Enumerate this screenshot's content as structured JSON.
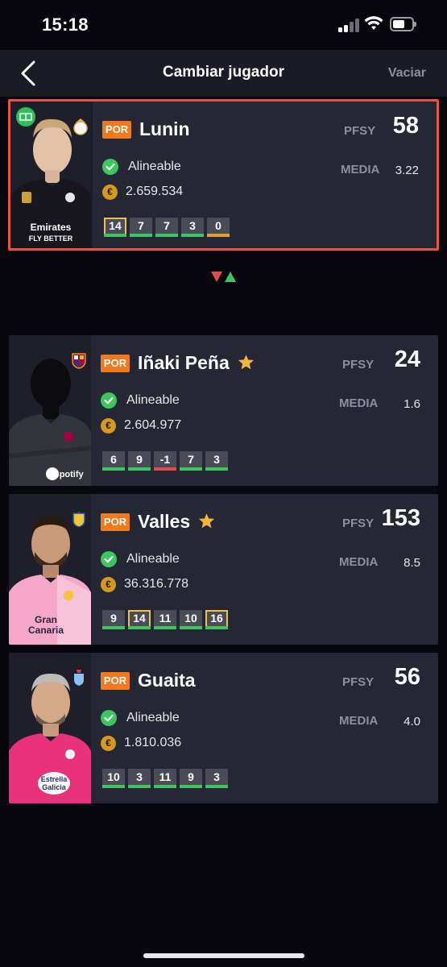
{
  "status_bar": {
    "time": "15:18"
  },
  "nav": {
    "back_icon": "chevron-left-icon",
    "title": "Cambiar jugador",
    "clear_label": "Vaciar"
  },
  "labels": {
    "pfsy": "PFSY",
    "media": "MEDIA",
    "coin": "€"
  },
  "selected_player": {
    "position": "POR",
    "name": "Lunin",
    "pfsy": "58",
    "status": "Alineable",
    "media": "3.22",
    "price": "2.659.534",
    "scores": [
      "14",
      "7",
      "7",
      "3",
      "0"
    ],
    "bar_colors": [
      "#3ec65e",
      "#3ec65e",
      "#3ec65e",
      "#3ec65e",
      "#e0a02a"
    ],
    "highlight_index": 0,
    "team": "Real Madrid",
    "shirt_sponsor": "Emirates\nFLY BETTER"
  },
  "swap_icon": "swap-arrows-icon",
  "players": [
    {
      "position": "POR",
      "name": "Iñaki Peña",
      "favorite": true,
      "pfsy": "24",
      "status": "Alineable",
      "media": "1.6",
      "price": "2.604.977",
      "scores": [
        "6",
        "9",
        "-1",
        "7",
        "3"
      ],
      "bar_colors": [
        "#3ec65e",
        "#3ec65e",
        "#e04a4a",
        "#3ec65e",
        "#3ec65e"
      ],
      "highlight_index": -1,
      "team": "FC Barcelona",
      "shirt_sponsor": "Spotify"
    },
    {
      "position": "POR",
      "name": "Valles",
      "favorite": true,
      "pfsy": "153",
      "status": "Alineable",
      "media": "8.5",
      "price": "36.316.778",
      "scores": [
        "9",
        "14",
        "11",
        "10",
        "16"
      ],
      "bar_colors": [
        "#3ec65e",
        "#3ec65e",
        "#3ec65e",
        "#3ec65e",
        "#3ec65e"
      ],
      "highlight_index": [
        1,
        4
      ],
      "team": "UD Las Palmas",
      "shirt_sponsor": "Gran\nCanaria"
    },
    {
      "position": "POR",
      "name": "Guaita",
      "favorite": false,
      "pfsy": "56",
      "status": "Alineable",
      "media": "4.0",
      "price": "1.810.036",
      "scores": [
        "10",
        "3",
        "11",
        "9",
        "3"
      ],
      "bar_colors": [
        "#3ec65e",
        "#3ec65e",
        "#3ec65e",
        "#3ec65e",
        "#3ec65e"
      ],
      "highlight_index": -1,
      "team": "RC Celta",
      "shirt_sponsor": "Estrella\nGalicia"
    }
  ]
}
